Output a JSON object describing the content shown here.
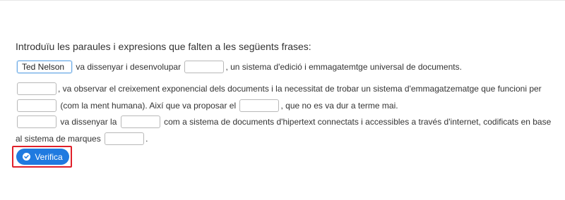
{
  "instruction": "Introduïu les paraules i expresions que falten a les següents frases:",
  "sentence1": {
    "blank1_value": "Ted Nelson",
    "text_a": "va dissenyar i desenvolupar",
    "text_b": ", un sistema d'edició i emmagatemtge universal de documents."
  },
  "sentence2": {
    "text_a": ", va observar el creixement exponencial dels documents i la necessitat de trobar un sistema d'emmagatzematge que funcioni per",
    "text_b": "(com la ment humana). Així que va proposar el",
    "text_c": ", que no es va dur a terme mai."
  },
  "sentence3": {
    "text_a": "va dissenyar la",
    "text_b": "com a sistema de documents d'hipertext connectats i accessibles a través d'internet, codificats en base al sistema de marques",
    "text_c": "."
  },
  "verify_button": {
    "label": "Verifica",
    "icon": "check-circle-icon"
  },
  "colors": {
    "button": "#1f7ae0",
    "highlight_border": "#e0202a"
  }
}
